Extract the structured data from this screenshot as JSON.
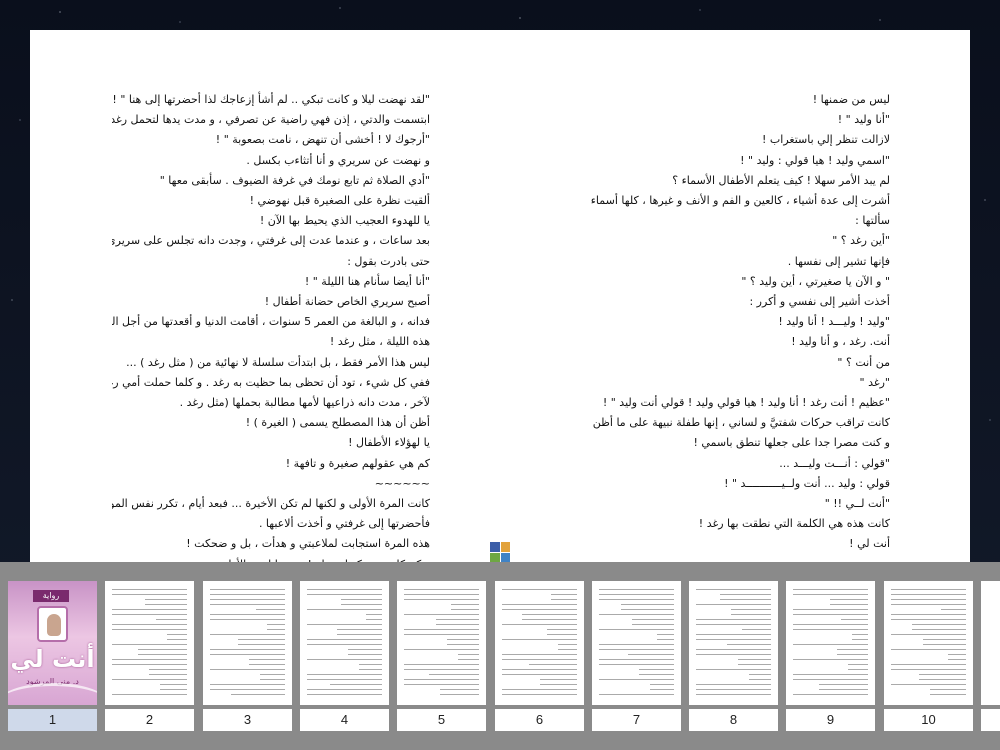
{
  "reader": {
    "left_page_lines": [
      "\"لقد نهضت ليلا و كانت تبكي .. لم أشأ إزعاجك لذا أحضرتها إلى هنا \" !",
      "ابتسمت والدتي ، إذن فهي راضية عن تصرفي ، و مدت يدها لتحمل رغد فاعترضت :",
      "\"أرجوك لا ! أخشى أن تنهض ، نامت بصعوبة \" !",
      "و نهضت عن سريري و أنا أتثاءب بكسل .",
      "\"أدي الصلاة ثم تابع نومك في غرفة الضيوف . سأبقى معها \"",
      "ألقيت نظرة على الصغيرة قبل نهوضي !",
      "يا للهدوء العجيب الذي يحيط بها الآن !",
      "بعد ساعات ، و عندما عدت إلى غرفتي ، وجدت دانه تجلس على سريري بمفردها . ما أن رأتني",
      "حتى بادرت بقول :",
      "\"أنا أيضا سأنام هنا الليلة \" !",
      "أصبح سريري الخاص حضانة أطفال !",
      "فدانه ، و البالغة من العمر 5 سنوات ، أقامت الدنيا و أقعدتها من أجل المبيت على سريري الجذاب",
      "هذه الليلة ، مثل رغد !",
      "ليس هذا الأمر فقط ، بل ابتدأت سلسلة لا نهائية من ( مثل رغد ) ...",
      "ففي كل شيء ، تود أن تحظى بما حظيت به رغد . و كلما حملت أمي رغد على كتفيها لسبب أو",
      "لآخر ، مدت دانه ذراعيها لأمها مطالبة بحملها (مثل رغد .",
      "أظن أن هذا المصطلح يسمى ( الغيرة ) !",
      "يا لهؤلاء الأطفال !",
      "كم هي عقولهم صغيرة و تافهة !",
      "~~~~~~",
      "كانت المرة الأولى و لكنها لم تكن الأخيرة ... فبعد أيام ، تكرر نفس الموقف ، و سمعت رغد تبكي",
      "فأحضرتها إلى غرفتي و أخذت ألاعبها .",
      "هذه المرة استجابت لملاعبتي و هدأت ، بل و ضحكت !",
      "و كم كانت ضحكتها جميلة ! سمعها لمرة الأولى"
    ],
    "right_page_lines": [
      "ليس من ضمنها !",
      "\"أنا وليد \" !",
      "لازالت تنظر إلي باستغراب !",
      "\"اسمي وليد ! هيا قولي : وليد \" !",
      "لم يبد الأمر سهلا ! كيف يتعلم الأطفال الأسماء ؟",
      "أشرت إلى عدة أشياء ، كالعين و الفم و الأنف و غيرها ، كلها أسماء تنطق بها و تعرفها . حتى حين",
      "سألتها :",
      "\"أين رغد ؟ \"",
      "فإنها تشير إلى نفسها .",
      "\" و الآن يا صغيرتي ، أين وليد ؟ \"",
      "أخذت أشير إلى نفسي و أكرر :",
      "\"وليد ! وليـــد ! أنا وليد !",
      "أنت. رغد ، و أنا وليد !",
      "من أنت ؟ \"",
      "\"رغد \"",
      "\"عظيم ! أنت رغد ! أنا وليد ! هيا قولي وليد ! قولي أنت وليد \" !",
      "كانت تراقب حركات شفتيَّ و لساني ، إنها طفلة نبيهة على ما أظن .",
      "و كنت مصرا جدا على جعلها تنطق باسمي !",
      "\"قولي : أنـــت وليـــد ...",
      "قولي : وليد ... أنت ولــيـــــــــــد \" !",
      "\"أنت لــي !! \"",
      "كانت هذه هي الكلمة التي نطقت بها رغد !",
      "أنت لي !"
    ]
  },
  "thumbnails": {
    "cover_tag": "رواية",
    "cover_title": "أنت لي",
    "cover_author": "د. منى المرشود",
    "pages": [
      {
        "number": "1",
        "active": true
      },
      {
        "number": "2"
      },
      {
        "number": "3"
      },
      {
        "number": "4"
      },
      {
        "number": "5"
      },
      {
        "number": "6"
      },
      {
        "number": "7"
      },
      {
        "number": "8"
      },
      {
        "number": "9"
      },
      {
        "number": "10"
      }
    ]
  },
  "colors": {
    "background": "#0b1220",
    "strip": "#8a8a8a",
    "active_label": "#cfd9ea",
    "cover_accent": "#7a2a6d"
  }
}
